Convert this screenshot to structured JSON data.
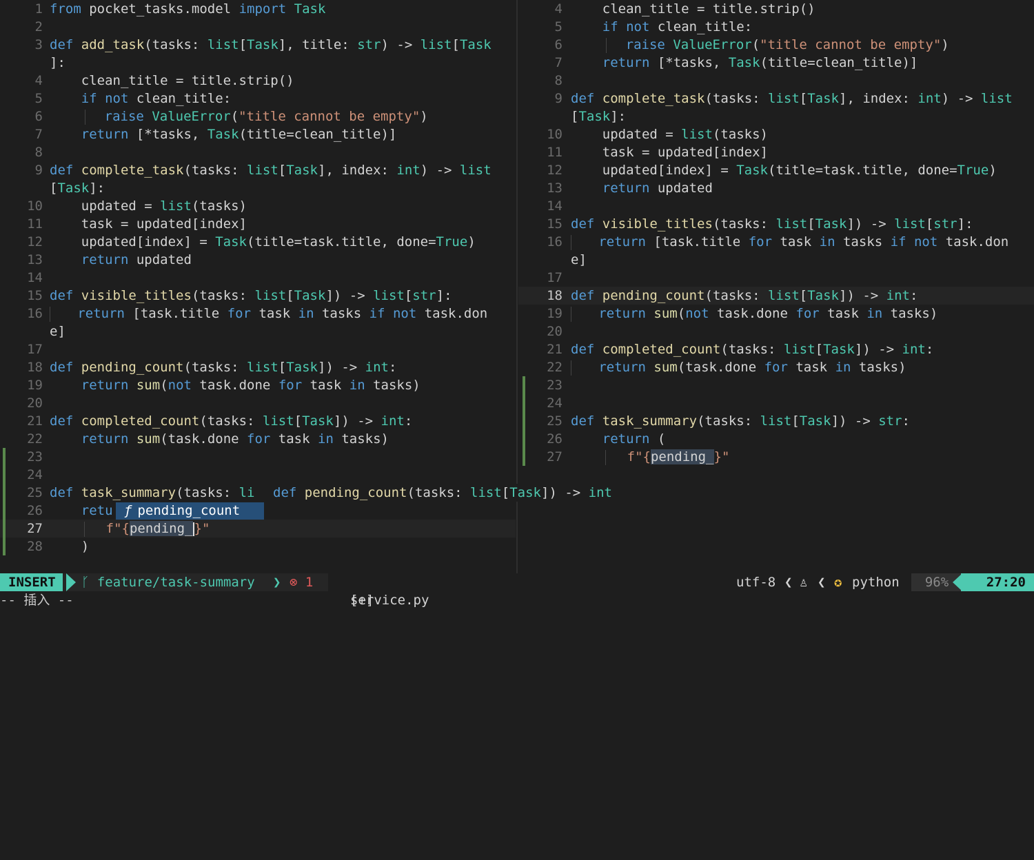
{
  "editor": {
    "left_pane": {
      "line_numbers": [
        "1",
        "2",
        "3",
        "",
        "4",
        "5",
        "6",
        "7",
        "8",
        "9",
        "",
        "10",
        "11",
        "12",
        "13",
        "14",
        "15",
        "16",
        "",
        "17",
        "18",
        "19",
        "20",
        "21",
        "22",
        "23",
        "24",
        "25",
        "26",
        "27",
        "28"
      ]
    },
    "right_pane": {
      "line_numbers": [
        "4",
        "5",
        "6",
        "7",
        "8",
        "9",
        "",
        "10",
        "11",
        "12",
        "13",
        "14",
        "15",
        "16",
        "",
        "17",
        "18",
        "19",
        "20",
        "21",
        "22",
        "23",
        "24",
        "25",
        "26",
        "27"
      ]
    },
    "tokens": {
      "from": "from",
      "import": "import",
      "def": "def",
      "return": "return",
      "if": "if",
      "not": "not",
      "raise": "raise",
      "for": "for",
      "in": "in",
      "module": "pocket_tasks.model",
      "Task": "Task",
      "list": "list",
      "str": "str",
      "int": "int",
      "True": "True",
      "add_task": "add_task",
      "complete_task": "complete_task",
      "visible_titles": "visible_titles",
      "pending_count": "pending_count",
      "completed_count": "completed_count",
      "task_summary": "task_summary",
      "sum": "sum",
      "ValueError": "ValueError",
      "err_msg": "\"title cannot be empty\"",
      "fstr_prefix": "f\"{",
      "fstr_suffix": "}\"",
      "fstr_suffix_after_cursor": "}\"",
      "typed": "pending_"
    },
    "code_text": {
      "tasks_param": "(tasks: ",
      "lb": "[",
      "rb": "]",
      "rbc": "]:",
      "comma_title": "], title: ",
      "arrow": ") -> ",
      "lparen": "(",
      "comma_index": "], index: ",
      "rb_paren": "]) -> ",
      "colon": ":",
      "clean_title_assign": "clean_title = title.strip()",
      "clean_title": " clean_title:",
      "ret_list": " [*tasks, ",
      "title_kw": "(title=clean_title)]",
      "updated_assign": "updated = ",
      "tasks_call": "(tasks)",
      "task_assign": "task = updated[index]",
      "updated_index": "updated[index] = ",
      "title_task": "(title=task.title, done=",
      "rparen": ")",
      "updated": " updated",
      "vis_ret_a": " [task.title ",
      "task_sp": " task ",
      "tasks_sp": " tasks ",
      "task_don": " task.don",
      "e_rb": "e]",
      "not_task_done": "(",
      "task_done": " task.done ",
      "task_done_paren": "(task.done ",
      "tasks_rparen": " tasks)",
      "ret_open": " (",
      "retu_trunc": "retu",
      "li_trunc": "li ",
      "summary_head_a": "(tasks: ",
      "close_paren": ")",
      "sig_tail": " -> "
    },
    "completion": {
      "signature_def": "def",
      "signature_name": "pending_count",
      "signature_params_a": "(tasks: ",
      "signature_list": "list",
      "signature_lb": "[",
      "signature_task": "Task",
      "signature_rb": "])",
      "signature_arrow": " -> ",
      "signature_ret": "int",
      "item_icon": "ƒ",
      "item_label": "pending_count"
    }
  },
  "statusline": {
    "mode": "INSERT",
    "branch_icon": "branch-icon",
    "branch": "feature/task-summary",
    "error_icon": "error-circle-icon",
    "error_count": "1",
    "filename": "service.py",
    "modified": "[+]",
    "encoding": "utf-8",
    "os_icon": "linux-tux-icon",
    "lang_icon": "python-icon",
    "filetype": "python",
    "percent": "96%",
    "position": "27:20"
  },
  "cmdline": {
    "text": "-- 插入 --"
  },
  "colors": {
    "accent": "#4ec9b0",
    "keyword": "#569cd6",
    "string": "#ce9178",
    "error": "#e05a5a",
    "git_added": "#5a8a4c"
  }
}
